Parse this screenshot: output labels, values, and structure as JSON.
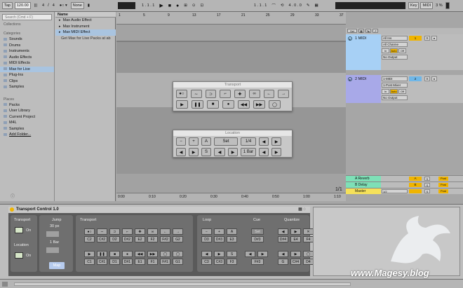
{
  "toolbar": {
    "tap": "Tap",
    "bpm": "120.00",
    "sig_num": "4",
    "sig_den": "4",
    "metro": "None",
    "pos": "1 . 1 . 1",
    "loop_start": "1 . 1 . 1",
    "loop_len": "4 . 0 . 0",
    "key": "Key",
    "midi": "MIDI",
    "cpu": "3 %"
  },
  "browser": {
    "search": "Search (Cmd + F)",
    "collections": "Collections",
    "categories": "Categories",
    "cats": [
      "Sounds",
      "Drums",
      "Instruments",
      "Audio Effects",
      "MIDI Effects",
      "Max for Live",
      "Plug-Ins",
      "Clips",
      "Samples"
    ],
    "places": "Places",
    "place_items": [
      "Packs",
      "User Library",
      "Current Project",
      "M4L",
      "Samples",
      "Add Folder..."
    ],
    "col_name": "Name",
    "files": [
      "Max Audio Effect",
      "Max Instrument",
      "Max MIDI Effect"
    ],
    "hint": "Get Max for Live Packs at ab"
  },
  "ruler": {
    "bars": [
      "1",
      "5",
      "9",
      "13",
      "17",
      "21",
      "25",
      "29",
      "33",
      "37"
    ],
    "times": [
      "0:00",
      "0:10",
      "0:20",
      "0:30",
      "0:40",
      "0:50",
      "1:00",
      "1:10"
    ],
    "ratio": "1/1"
  },
  "tracks": [
    {
      "name": "1 MIDI",
      "in": "All Ins",
      "ch": "All Channe",
      "mon1": "In",
      "mon2": "Auto",
      "mon3": "Off",
      "out": "No Output",
      "num": "1",
      "s": "S",
      "color": "#a7d0f5"
    },
    {
      "name": "2 MIDI",
      "in": "1-MIDI",
      "ch": "1-Post Mixer",
      "mon1": "In",
      "mon2": "Auto",
      "mon3": "Off",
      "out": "No Output",
      "num": "2",
      "s": "S",
      "color": "#a8a9e8"
    }
  ],
  "returns": [
    {
      "name": "A Reverb",
      "num": "A",
      "s": "S",
      "post": "Post",
      "color": "#7ee0b7"
    },
    {
      "name": "B Delay",
      "num": "B",
      "s": "S",
      "post": "Post",
      "color": "#7ee0b7"
    },
    {
      "name": "Master",
      "num": "",
      "s": "S",
      "post": "Post",
      "color": "#f5e15a",
      "sel": "1/2"
    }
  ],
  "transport_win": {
    "title": "Transport"
  },
  "location_win": {
    "title": "Location",
    "row1": [
      "A",
      "Set",
      "1/4"
    ],
    "row2": [
      "S",
      "1 Bar"
    ]
  },
  "device": {
    "title": "Transport Control 1.0",
    "transport": "Transport",
    "on": "On",
    "location": "Location",
    "jump": "Jump",
    "jump_val": "30 px",
    "bar": "1 Bar",
    "map": "Map",
    "sec_transport": "Transport",
    "t_labels1": [
      "C2",
      "C#2",
      "D2",
      "D#2",
      "E2",
      "F2",
      "F#2",
      "G2"
    ],
    "t_labels2": [
      "C1",
      "C#1",
      "D1",
      "D#1",
      "E1",
      "F1",
      "F#1",
      "G1"
    ],
    "sec_loop": "Loop",
    "loop_l1": [
      "D3",
      "D#3",
      "E3"
    ],
    "loop_l2": [
      "C3",
      "C#3",
      "F3"
    ],
    "sec_cue": "Cue",
    "cue_set": "Set",
    "cue_l1": "D#3",
    "cue_l2": "F#3",
    "sec_quant": "Quantize",
    "q_l1": [
      "D#4",
      "E4",
      "F4"
    ],
    "q_l2": [
      "G",
      "C#4",
      "D4"
    ]
  },
  "watermark": "www.Magesy.blog"
}
